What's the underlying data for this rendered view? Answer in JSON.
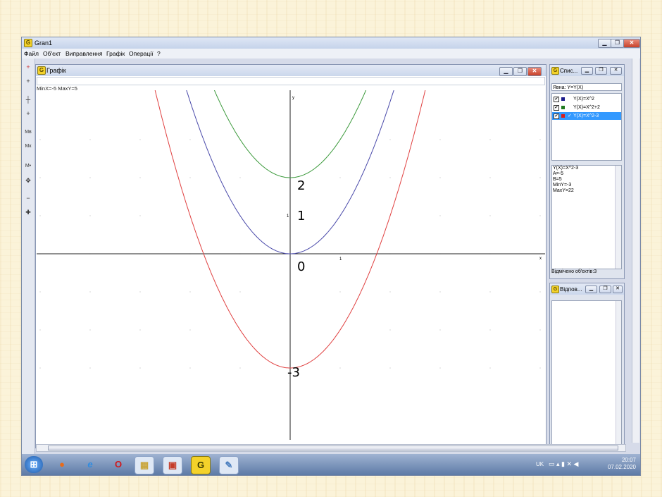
{
  "app": {
    "title": "Gran1",
    "menu": [
      "Файл",
      "Об'єкт",
      "Виправлення",
      "Графік",
      "Операції",
      "?"
    ]
  },
  "toolbar": {
    "tools": [
      {
        "name": "add-point-tool",
        "glyph": "+"
      },
      {
        "name": "cross-tool",
        "glyph": "+"
      },
      {
        "name": "coordinate-tool",
        "glyph": "┼"
      },
      {
        "name": "plus-tool",
        "glyph": "+"
      },
      {
        "name": "mb-tool",
        "glyph": "Mв"
      },
      {
        "name": "mk-tool",
        "glyph": "Mк"
      },
      {
        "name": "mdot-tool",
        "glyph": "M•"
      },
      {
        "name": "move-tool",
        "glyph": "✥"
      },
      {
        "name": "minus-tool",
        "glyph": "−"
      },
      {
        "name": "plus-small-tool",
        "glyph": "✚"
      }
    ]
  },
  "graph_window": {
    "title": "Графік",
    "status": "MinX=-5  MaxY=5",
    "axis_x_label": "x",
    "axis_y_label": "y",
    "tick_one": "1",
    "labels": {
      "two": "2",
      "one": "1",
      "zero": "0",
      "minus_three": "-3"
    }
  },
  "list_window": {
    "title": "Спис...",
    "field": "Явна: Y=Y(X)",
    "items": [
      {
        "label": "Y(X)=X^2",
        "color": "#1a1a8a",
        "checked": "✔"
      },
      {
        "label": "Y(X)=X^2+2",
        "color": "#1f7a1f",
        "checked": "✔"
      },
      {
        "label": "Y(X)=X^2-3",
        "color": "#d42020",
        "checked": "✔",
        "selected": true
      }
    ],
    "selected_mark": "✓",
    "info": [
      "Y(X)=X^2-3",
      "A=-5",
      "B=5",
      "MinY=-3",
      "MaxY=22"
    ],
    "footer": "Відмічено об'єктів:3"
  },
  "response_window": {
    "title": "Відпов..."
  },
  "taskbar": {
    "lang": "UK",
    "time": "20:07",
    "date": "07.02.2020",
    "apps": [
      {
        "name": "start-button",
        "glyph": "⊞",
        "color": "#2b6fd1"
      },
      {
        "name": "firefox-icon",
        "glyph": "●",
        "color": "#e86b1a"
      },
      {
        "name": "internet-explorer-icon",
        "glyph": "e",
        "color": "#2f8ce0"
      },
      {
        "name": "opera-icon",
        "glyph": "O",
        "color": "#d0181b"
      },
      {
        "name": "file-manager-icon",
        "glyph": "▦",
        "color": "#c9a53b"
      },
      {
        "name": "slideshow-icon",
        "glyph": "▣",
        "color": "#c53b28"
      },
      {
        "name": "gran-icon",
        "glyph": "G",
        "color": "#3a3a00"
      },
      {
        "name": "paint-icon",
        "glyph": "✎",
        "color": "#4b7fbf"
      }
    ]
  },
  "chart_data": {
    "type": "line",
    "xlim": [
      -5,
      5
    ],
    "ylim": [
      -3.3,
      3.7
    ],
    "grid": true,
    "series": [
      {
        "formula": "Y(X)=X^2",
        "color": "#4a4aaa",
        "a": 1,
        "c": 0
      },
      {
        "formula": "Y(X)=X^2+2",
        "color": "#3c9a3c",
        "a": 1,
        "c": 2
      },
      {
        "formula": "Y(X)=X^2-3",
        "color": "#e04040",
        "a": 1,
        "c": -3
      }
    ]
  }
}
